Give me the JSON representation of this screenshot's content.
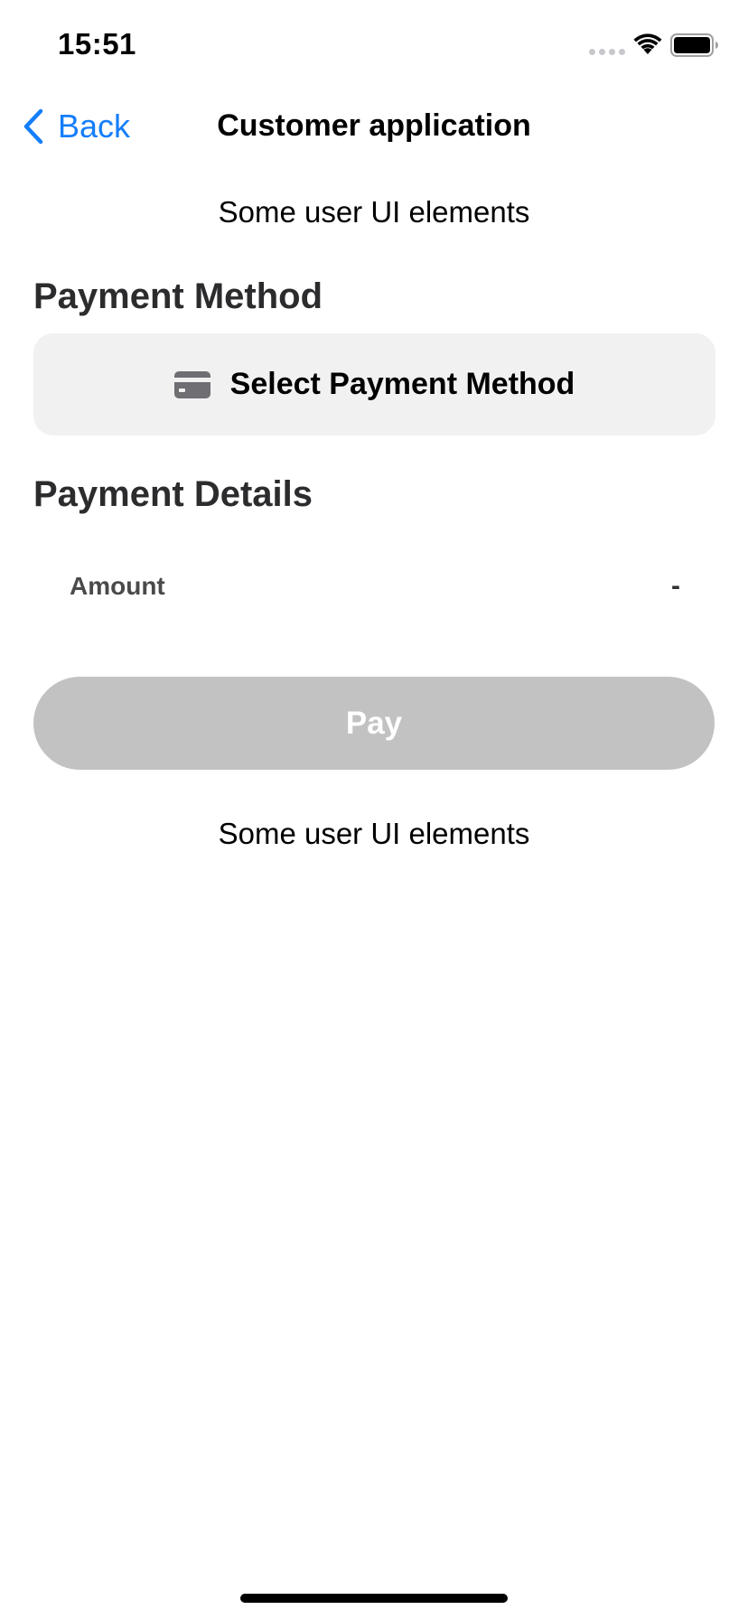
{
  "status_bar": {
    "time": "15:51",
    "icons": [
      "signal-dots-icon",
      "wifi-icon",
      "battery-icon"
    ]
  },
  "nav": {
    "back_label": "Back",
    "title": "Customer application"
  },
  "content": {
    "top_placeholder": "Some user UI elements",
    "payment_method_header": "Payment Method",
    "select_method_label": "Select Payment Method",
    "select_method_icon": "credit-card-icon",
    "payment_details_header": "Payment Details",
    "amount_label": "Amount",
    "amount_value": "-",
    "pay_label": "Pay",
    "bottom_placeholder": "Some user UI elements"
  },
  "colors": {
    "accent": "#147EFB",
    "select_button_bg": "#F1F1F1",
    "pay_button_disabled_bg": "#C2C2C2",
    "section_header": "#2C2C2E"
  }
}
